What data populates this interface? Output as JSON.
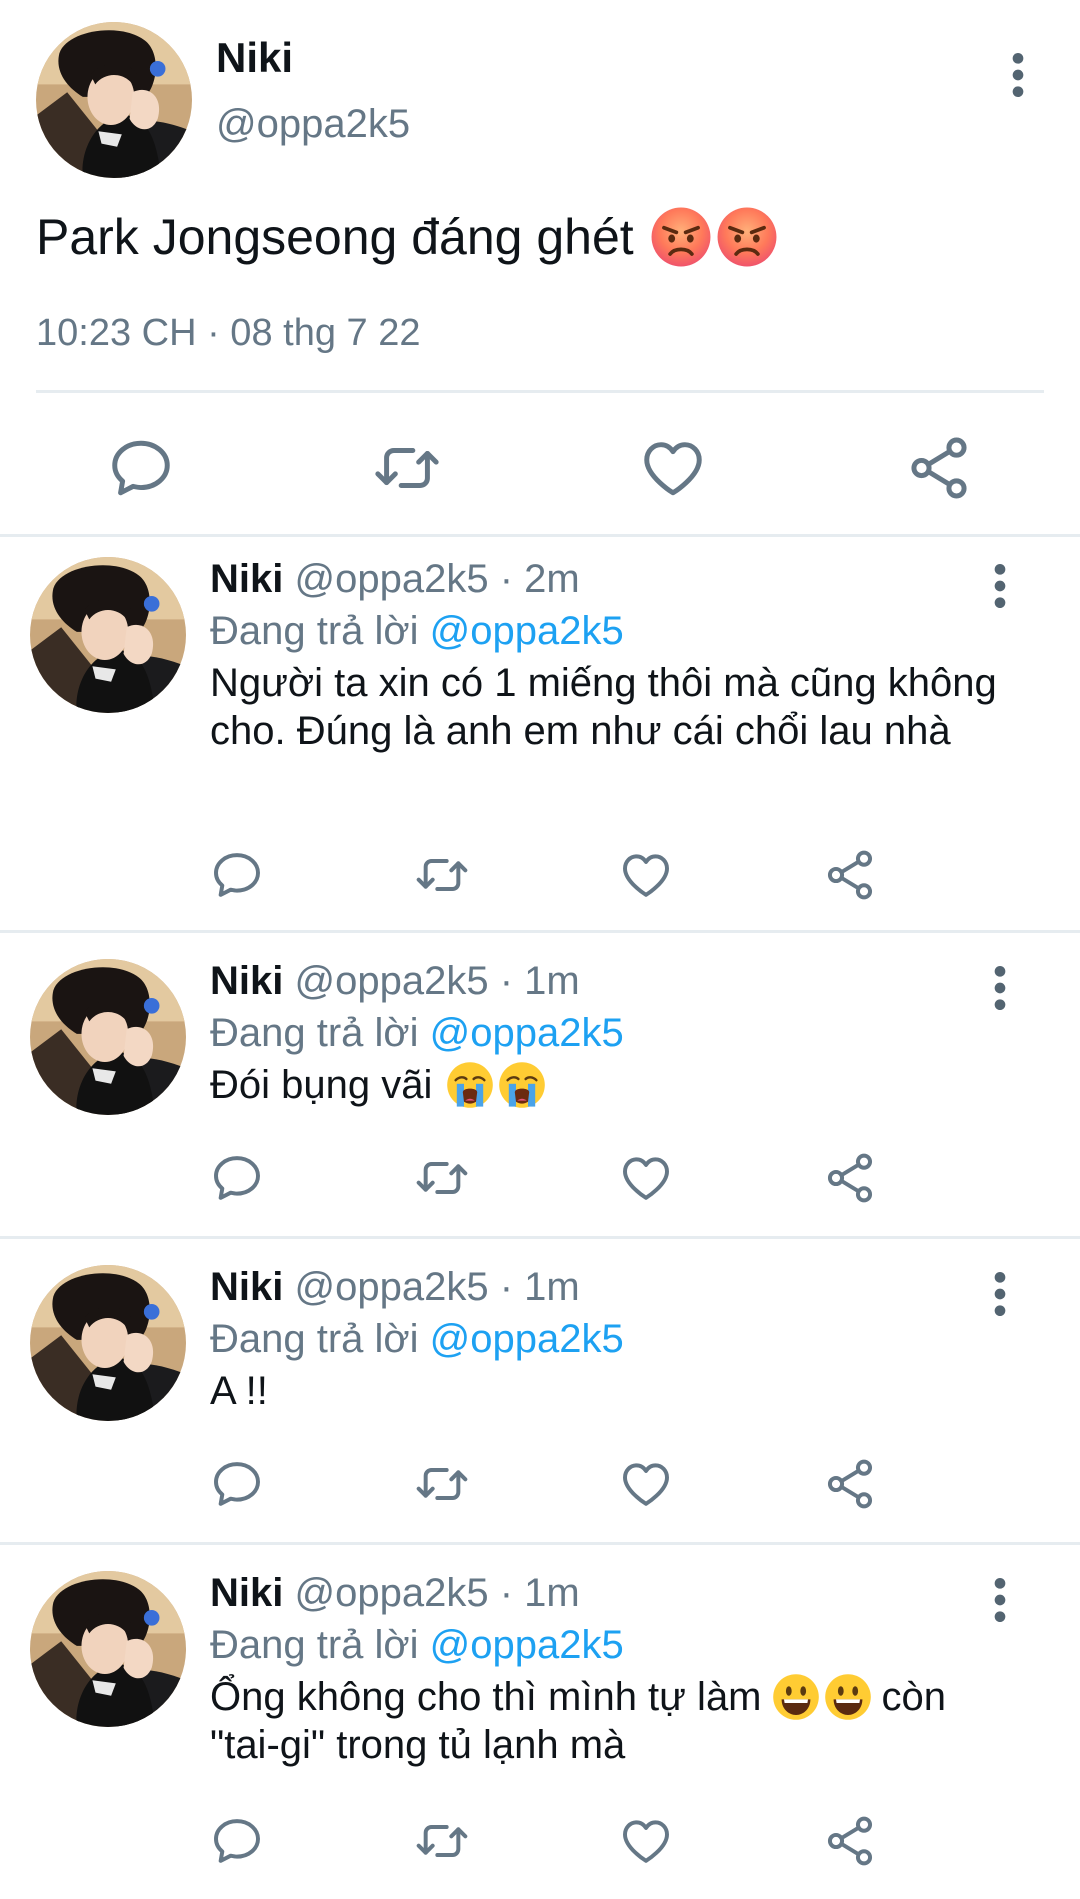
{
  "main_tweet": {
    "name": "Niki",
    "handle": "@oppa2k5",
    "text": "Park Jongseong đáng ghét",
    "emojis": [
      "angry-face-emoji",
      "angry-face-emoji"
    ],
    "timestamp": "10:23 CH · 08 thg 7 22"
  },
  "replies": [
    {
      "name": "Niki",
      "handle": "@oppa2k5",
      "time": "· 2m",
      "replying_label": "Đang trả lời",
      "replying_to": "@oppa2k5",
      "text": "Người ta xin có 1 miếng thôi mà cũng không cho. Đúng là anh em như cái chổi lau nhà"
    },
    {
      "name": "Niki",
      "handle": "@oppa2k5",
      "time": "· 1m",
      "replying_label": "Đang trả lời",
      "replying_to": "@oppa2k5",
      "text": "Đói bụng vãi",
      "emojis": [
        "crying-face-emoji",
        "crying-face-emoji"
      ]
    },
    {
      "name": "Niki",
      "handle": "@oppa2k5",
      "time": "· 1m",
      "replying_label": "Đang trả lời",
      "replying_to": "@oppa2k5",
      "text": "A !!"
    },
    {
      "name": "Niki",
      "handle": "@oppa2k5",
      "time": "· 1m",
      "replying_label": "Đang trả lời",
      "replying_to": "@oppa2k5",
      "text_a": "Ổng không cho thì mình tự làm",
      "text_b": "còn",
      "text_c": "\"tai-gi\" trong tủ lạnh mà",
      "emojis": [
        "grinning-face-emoji",
        "grinning-face-emoji"
      ]
    }
  ],
  "colors": {
    "text": "#0f1419",
    "secondary": "#657786",
    "link": "#1da1f2",
    "divider": "#e6ecf0"
  },
  "icons": [
    "reply-icon",
    "retweet-icon",
    "like-icon",
    "share-icon",
    "more-options-icon"
  ]
}
